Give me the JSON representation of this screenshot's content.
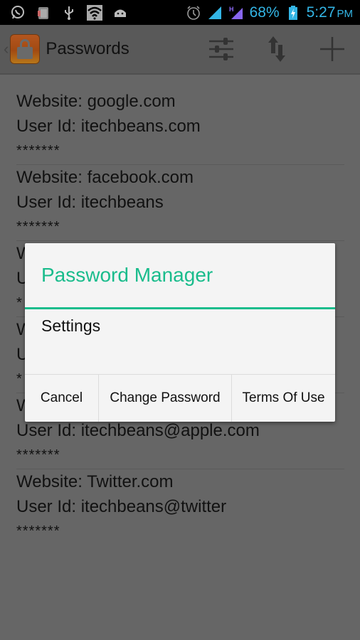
{
  "status_bar": {
    "left_icons": [
      "whatsapp-icon",
      "app-drawer-icon",
      "usb-icon",
      "wifi-icon",
      "android-icon"
    ],
    "right_icons": [
      "alarm-icon",
      "signal-icon",
      "signal-h-icon",
      "battery-charging-icon"
    ],
    "network_type": "H",
    "battery": "68%",
    "time": "5:27",
    "ampm": "PM",
    "accent_color": "#33b5e5"
  },
  "action_bar": {
    "title": "Passwords",
    "up_indicator": "‹",
    "app_icon": "lock-icon",
    "actions": [
      {
        "name": "settings-sliders",
        "icon": "sliders-icon"
      },
      {
        "name": "sort",
        "icon": "sort-arrows-icon"
      },
      {
        "name": "add",
        "icon": "plus-icon"
      }
    ]
  },
  "entries": [
    {
      "website": "Website: google.com",
      "user": "User Id: itechbeans.com",
      "password": "*******"
    },
    {
      "website": "Website: facebook.com",
      "user": "User Id: itechbeans",
      "password": "*******"
    },
    {
      "website": "W",
      "user": "U",
      "password": "*"
    },
    {
      "website": "W",
      "user": "U",
      "password": "*"
    },
    {
      "website": "W",
      "user": "User Id: itechbeans@apple.com",
      "password": "*******"
    },
    {
      "website": "Website: Twitter.com",
      "user": "User Id: itechbeans@twitter",
      "password": "*******"
    }
  ],
  "dialog": {
    "title": "Password Manager",
    "accent_color": "#1abc8c",
    "message": "Settings",
    "buttons": {
      "cancel": "Cancel",
      "change_password": "Change Password",
      "terms": "Terms Of Use"
    }
  }
}
